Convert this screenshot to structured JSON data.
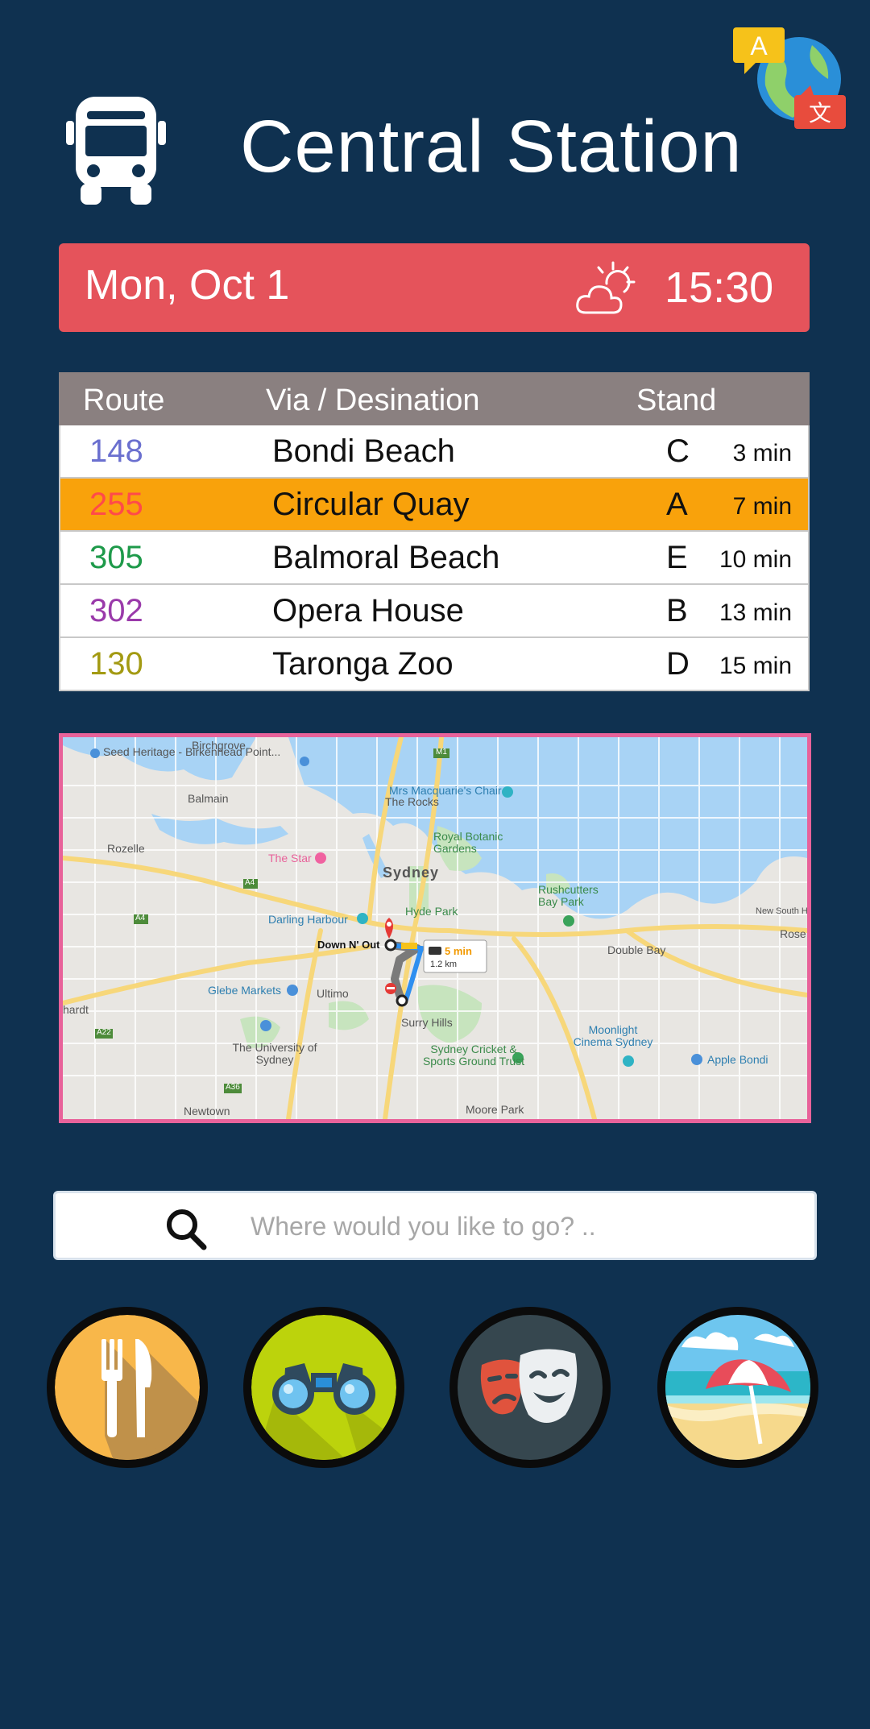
{
  "header": {
    "title": "Central Station",
    "bus_icon": "bus-icon",
    "translate_icon": "translate-icon",
    "translate_glyph_a": "A",
    "translate_glyph_zh": "文"
  },
  "datebar": {
    "date": "Mon, Oct 1",
    "time": "15:30",
    "weather_icon": "partly-cloudy-icon",
    "color": "#e5535b"
  },
  "departures": {
    "headers": {
      "route": "Route",
      "destination": "Via / Desination",
      "stand": "Stand"
    },
    "rows": [
      {
        "route": "148",
        "destination": "Bondi Beach",
        "stand": "C",
        "eta": "3 min",
        "route_color": "#6a6fcf",
        "bg": "#ffffff"
      },
      {
        "route": "255",
        "destination": "Circular Quay",
        "stand": "A",
        "eta": "7 min",
        "route_color": "#ff4a4a",
        "bg": "#f9a20b"
      },
      {
        "route": "305",
        "destination": "Balmoral Beach",
        "stand": "E",
        "eta": "10 min",
        "route_color": "#1e9a4a",
        "bg": "#ffffff"
      },
      {
        "route": "302",
        "destination": "Opera House",
        "stand": "B",
        "eta": "13 min",
        "route_color": "#9a3aaa",
        "bg": "#ffffff"
      },
      {
        "route": "130",
        "destination": "Taronga Zoo",
        "stand": "D",
        "eta": "15 min",
        "route_color": "#a39a12",
        "bg": "#ffffff"
      }
    ]
  },
  "map": {
    "labels": {
      "seed": "Seed Heritage - Birkenhead Point...",
      "birchgrove": "Birchgrove",
      "balmain": "Balmain",
      "rozelle": "Rozelle",
      "star": "The Star",
      "darling": "Darling Harbour",
      "sydney": "Sydney",
      "rocks": "The Rocks",
      "macquarie": "Mrs Macquarie's Chair",
      "botanic": "Royal Botanic Gardens",
      "hyde": "Hyde Park",
      "rush": "Rushcutters Bay Park",
      "double": "Double Bay",
      "rose": "Rose B",
      "newsouth": "New South Head Rd",
      "glebe": "Glebe Markets",
      "ultimo": "Ultimo",
      "surry": "Surry Hills",
      "uni": "The University of Sydney",
      "cricket": "Sydney Cricket & Sports Ground Trust",
      "moonlight": "Moonlight Cinema Sydney",
      "apple": "Apple Bondi",
      "moore": "Moore Park",
      "newtown": "Newtown",
      "downnout": "Down N' Out",
      "m1": "M1",
      "a4": "A4",
      "a22": "A22",
      "a36": "A36",
      "hardt": "hardt"
    },
    "route_popup": {
      "time": "5 min",
      "distance": "1.2 km"
    }
  },
  "search": {
    "placeholder": "Where would you like to go? ..",
    "value": ""
  },
  "categories": [
    {
      "name": "restaurant",
      "icon": "fork-knife-icon"
    },
    {
      "name": "sightseeing",
      "icon": "binoculars-icon"
    },
    {
      "name": "theatre",
      "icon": "theatre-masks-icon"
    },
    {
      "name": "beach",
      "icon": "beach-umbrella-icon"
    }
  ]
}
